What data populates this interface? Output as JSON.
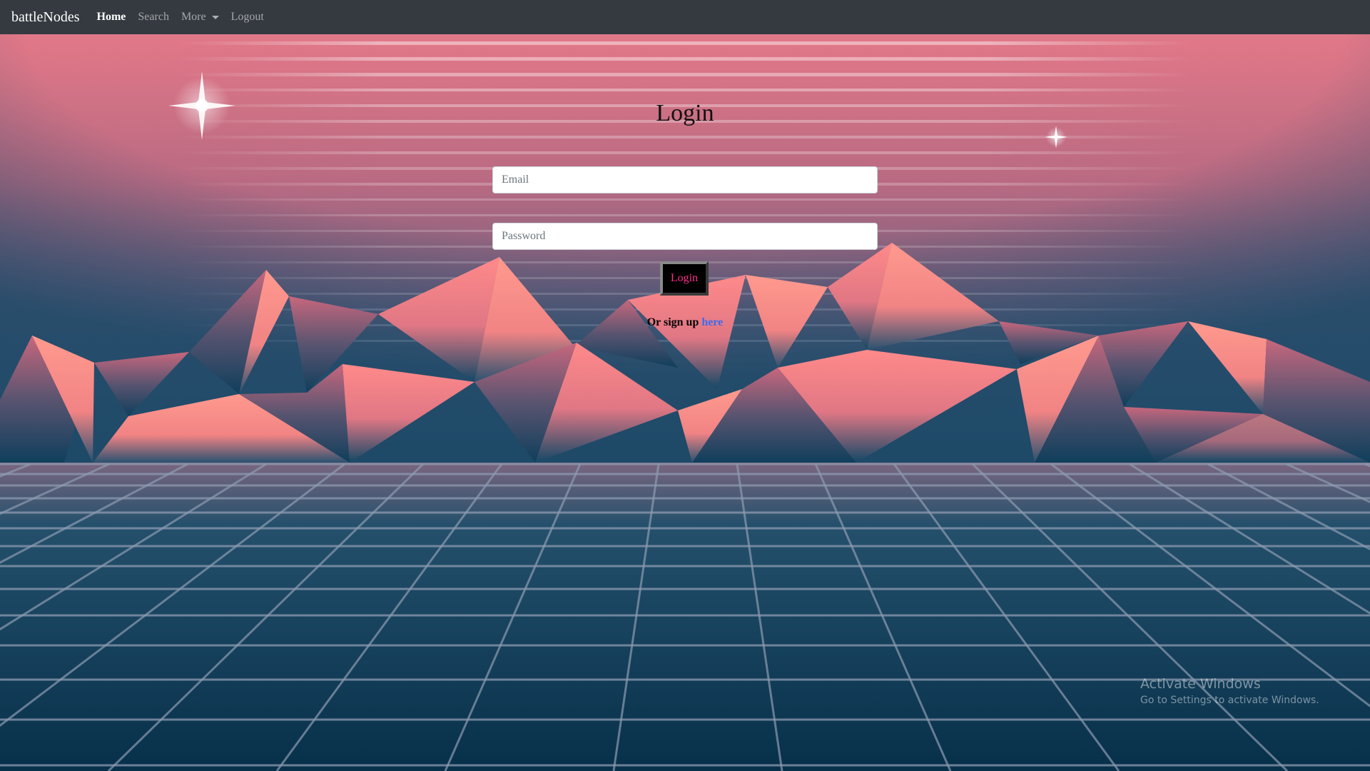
{
  "navbar": {
    "brand": "battleNodes",
    "items": [
      {
        "label": "Home"
      },
      {
        "label": "Search"
      },
      {
        "label": "More"
      },
      {
        "label": "Logout"
      }
    ]
  },
  "login": {
    "title": "Login",
    "email_placeholder": "Email",
    "password_placeholder": "Password",
    "button_label": "Login",
    "signup_prefix": "Or sign up ",
    "signup_link": "here"
  },
  "watermark": {
    "title": "Activate Windows",
    "subtitle": "Go to Settings to activate Windows."
  },
  "colors": {
    "navbar_bg": "#343a40",
    "sky_top": "#e27888",
    "sky_horizon": "#1d4a68",
    "ground": "#0a3450",
    "grid_line": "#7f8ea2",
    "mountain_peak": "#ff8a8a",
    "mountain_base": "#134866",
    "button_text": "#ff2e88",
    "link": "#3b6cf0"
  },
  "icons": {
    "large_star": "sparkle-star-icon",
    "small_star": "sparkle-star-icon"
  }
}
